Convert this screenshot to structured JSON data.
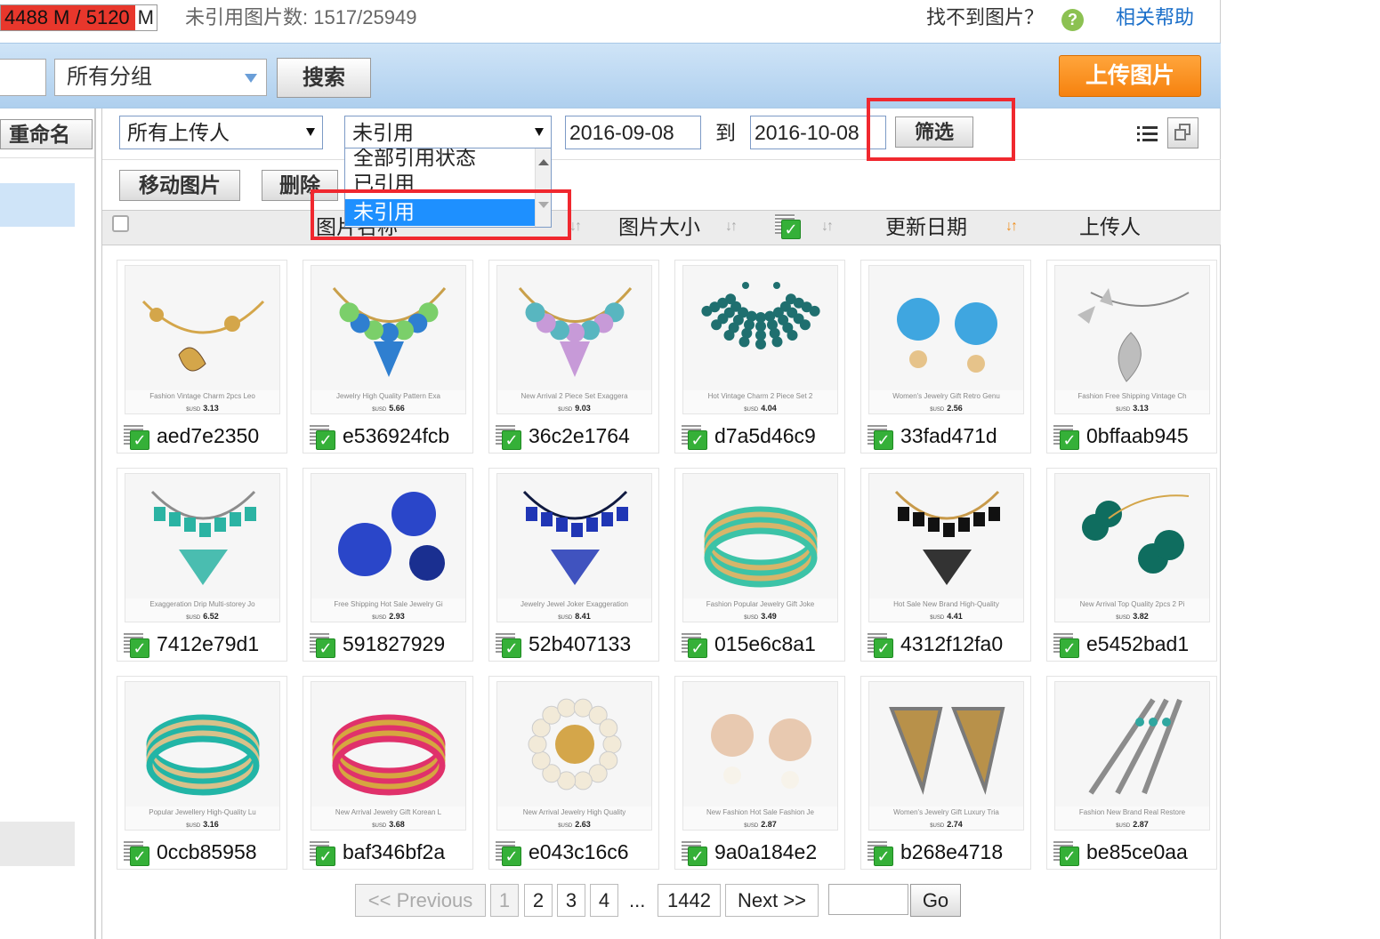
{
  "topbar": {
    "quota_used": "4488 M / 5120",
    "quota_unit": "M",
    "unreferenced_count": "未引用图片数: 1517/25949",
    "cant_find": "找不到图片？",
    "help_icon": "?",
    "help_link": "相关帮助"
  },
  "search": {
    "keyword_value": "",
    "group_select": "所有分组",
    "search_button": "搜索",
    "upload_button": "上传图片"
  },
  "left_panel": {
    "rename_button": "重命名"
  },
  "filters": {
    "uploader": "所有上传人",
    "reference_status": "未引用",
    "date_from": "2016-09-08",
    "to_label": "到",
    "date_to": "2016-10-08",
    "filter_button": "筛选",
    "status_options": [
      "全部引用状态",
      "已引用",
      "未引用"
    ]
  },
  "actions": {
    "move_button": "移动图片",
    "delete_button": "删除"
  },
  "columns": {
    "name": "图片名称",
    "size": "图片大小",
    "updated": "更新日期",
    "uploader": "上传人"
  },
  "colors": {
    "accent_orange": "#f6820f",
    "selection_blue": "#1e90ff",
    "highlight_red": "#f0282f",
    "check_green": "#35b038"
  },
  "images": [
    {
      "name": "aed7e2350",
      "title": "Fashion Vintage Charm 2pcs Leo",
      "price": "3.13",
      "art": "leopard",
      "c1": "#d4a64a",
      "c2": "#6b4a2a"
    },
    {
      "name": "e536924fcb",
      "title": "Jewelry High Quality Pattern Exa",
      "price": "5.66",
      "art": "flower-necklace",
      "c1": "#2f7fd0",
      "c2": "#7bcf6a"
    },
    {
      "name": "36c2e1764",
      "title": "New Arrival 2 Piece Set Exaggera",
      "price": "9.03",
      "art": "flower-necklace",
      "c1": "#c79ad8",
      "c2": "#58b6c0"
    },
    {
      "name": "d7a5d46c9",
      "title": "Hot Vintage Charm 2 Piece Set 2",
      "price": "4.04",
      "art": "pearl",
      "c1": "#1f6f6f",
      "c2": "#c49a50"
    },
    {
      "name": "33fad471d",
      "title": "Women's Jewelry Gift Retro Genu",
      "price": "2.56",
      "art": "earrings",
      "c1": "#3fa6e0",
      "c2": "#e6c38a"
    },
    {
      "name": "0bffaab945",
      "title": "Fashion Free Shipping Vintage Ch",
      "price": "3.13",
      "art": "leaf",
      "c1": "#bdbdbd",
      "c2": "#8a8a8a"
    },
    {
      "name": "7412e79d1",
      "title": "Exaggeration Drip Multi-storey Jo",
      "price": "6.52",
      "art": "bib",
      "c1": "#2bb3a3",
      "c2": "#8c8c8c"
    },
    {
      "name": "591827929",
      "title": "Free Shipping Hot Sale Jewelry Gi",
      "price": "2.93",
      "art": "balls",
      "c1": "#2a46c9",
      "c2": "#1a2f90"
    },
    {
      "name": "52b407133",
      "title": "Jewelry Jewel Joker Exaggeration",
      "price": "8.41",
      "art": "bib",
      "c1": "#2036b5",
      "c2": "#101a40"
    },
    {
      "name": "015e6c8a1",
      "title": "Fashion Popular Jewelry Gift Joke",
      "price": "3.49",
      "art": "bracelet",
      "c1": "#3cc3a7",
      "c2": "#d7b56a"
    },
    {
      "name": "4312f12fa0",
      "title": "Hot Sale New Brand High-Quality",
      "price": "4.41",
      "art": "bib",
      "c1": "#111111",
      "c2": "#c89a4a"
    },
    {
      "name": "e5452bad1",
      "title": "New Arrival Top Quality 2pcs 2 Pi",
      "price": "3.82",
      "art": "clover",
      "c1": "#0f6d5f",
      "c2": "#d4a64a"
    },
    {
      "name": "0ccb85958",
      "title": "Popular Jewellery High-Quality Lu",
      "price": "3.16",
      "art": "bracelet",
      "c1": "#22b5a6",
      "c2": "#d8c18a"
    },
    {
      "name": "baf346bf2a",
      "title": "New Arrival Jewelry Gift Korean L",
      "price": "3.68",
      "art": "bracelet",
      "c1": "#e0316b",
      "c2": "#d6a640"
    },
    {
      "name": "e043c16c6",
      "title": "New Arrival Jewelry High Quality",
      "price": "2.63",
      "art": "brooch",
      "c1": "#f2ead8",
      "c2": "#d4a64a"
    },
    {
      "name": "9a0a184e2",
      "title": "New Fashion Hot Sale Fashion Je",
      "price": "2.87",
      "art": "pearl-earrings",
      "c1": "#e8c9b0",
      "c2": "#f7f3ea"
    },
    {
      "name": "b268e4718",
      "title": "Women's Jewelry Gift Luxury Tria",
      "price": "2.74",
      "art": "triangle",
      "c1": "#b8914a",
      "c2": "#7a7a7a"
    },
    {
      "name": "be85ce0aa",
      "title": "Fashion New Brand Real Restore",
      "price": "2.87",
      "art": "feather",
      "c1": "#8c8c8c",
      "c2": "#2fa7a0"
    }
  ],
  "price_currency": "$USD",
  "pager": {
    "previous": "<< Previous",
    "pages": [
      "1",
      "2",
      "3",
      "4"
    ],
    "dots": "...",
    "last": "1442",
    "next": "Next >>",
    "go": "Go"
  }
}
